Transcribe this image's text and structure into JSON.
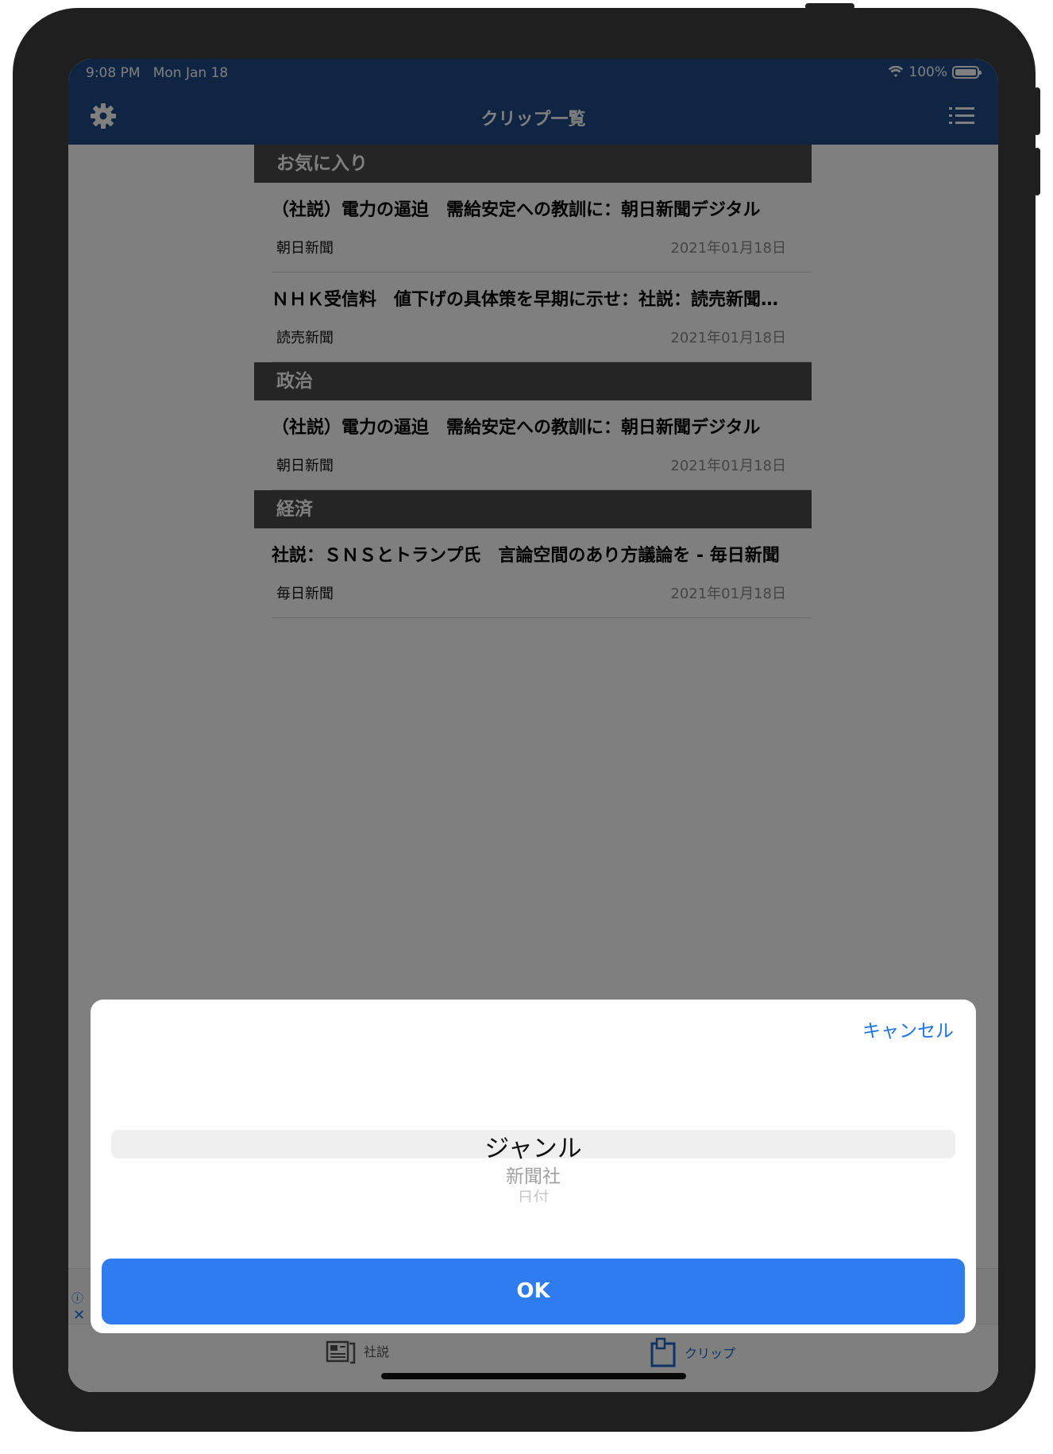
{
  "status_bar": {
    "time": "9:08 PM",
    "date": "Mon Jan 18",
    "battery": "100%"
  },
  "nav": {
    "title": "クリップ一覧"
  },
  "sections": [
    {
      "header": "お気に入り",
      "items": [
        {
          "title": "（社説）電力の逼迫　需給安定への教訓に：朝日新聞デジタル",
          "source": "朝日新聞",
          "date": "2021年01月18日"
        },
        {
          "title": "ＮＨＫ受信料　値下げの具体策を早期に示せ：社説：読売新聞オンライン",
          "source": "読売新聞",
          "date": "2021年01月18日"
        }
      ]
    },
    {
      "header": "政治",
      "items": [
        {
          "title": "（社説）電力の逼迫　需給安定への教訓に：朝日新聞デジタル",
          "source": "朝日新聞",
          "date": "2021年01月18日"
        }
      ]
    },
    {
      "header": "経済",
      "items": [
        {
          "title": "社説：ＳＮＳとトランプ氏　言論空間のあり方議論を - 毎日新聞",
          "source": "毎日新聞",
          "date": "2021年01月18日"
        }
      ]
    }
  ],
  "ad": {
    "info": "ⓘ",
    "close": "✕"
  },
  "tabs": {
    "editorial": "社説",
    "clip": "クリップ"
  },
  "sheet": {
    "cancel": "キャンセル",
    "options": [
      "ジャンル",
      "新聞社",
      "日付"
    ],
    "ok": "OK"
  },
  "colors": {
    "nav": "#1e4a86",
    "accent": "#2f7bf0",
    "link": "#1a73e8"
  }
}
